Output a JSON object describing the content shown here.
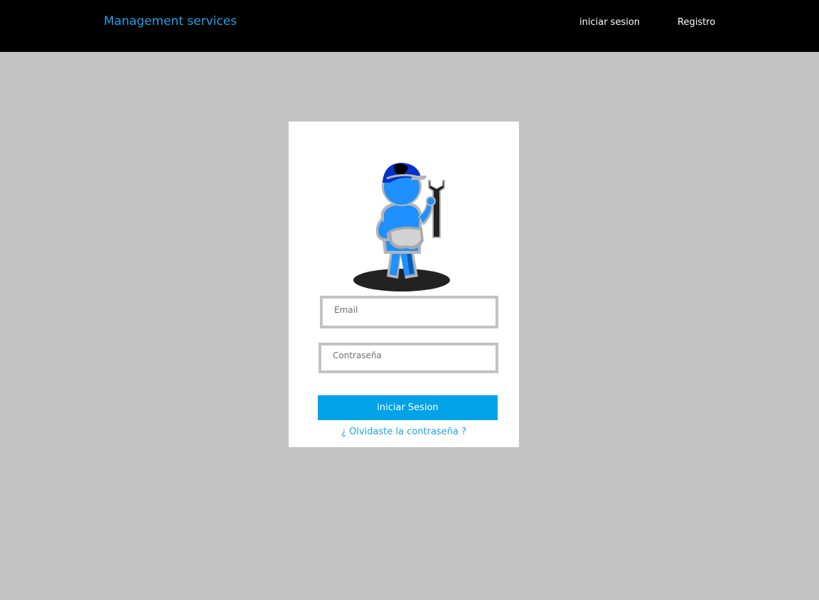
{
  "header": {
    "brand": "Management services",
    "nav": {
      "login": "iniciar sesion",
      "register": "Registro"
    }
  },
  "login_form": {
    "mascot_icon": "mechanic-with-wrench-icon",
    "email_placeholder": "Email",
    "password_placeholder": "Contraseña",
    "submit_label": "iniciar Sesion",
    "forgot_link": "¿ Olvidaste la contraseña ?"
  },
  "colors": {
    "header_bg": "#000000",
    "page_bg": "#c3c3c3",
    "brand": "#1aa3e8",
    "button": "#00a2e8",
    "link": "#1aa3e8"
  }
}
